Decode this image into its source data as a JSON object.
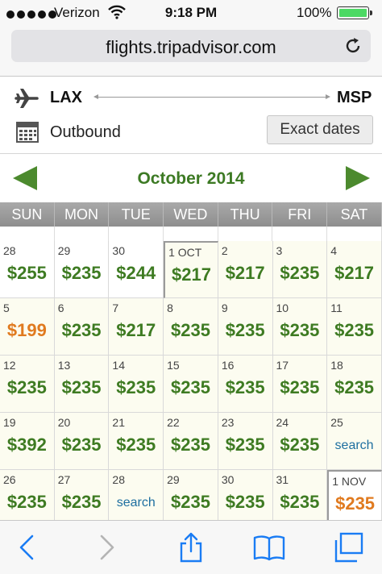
{
  "status": {
    "carrier": "Verizon",
    "time": "9:18 PM",
    "battery": "100%"
  },
  "browser": {
    "url": "flights.tripadvisor.com"
  },
  "route": {
    "origin": "LAX",
    "destination": "MSP",
    "direction": "Outbound",
    "exact_dates_label": "Exact dates"
  },
  "calendar": {
    "month_title": "October 2014",
    "weekdays": [
      "SUN",
      "MON",
      "TUE",
      "WED",
      "THU",
      "FRI",
      "SAT"
    ],
    "weeks": [
      [
        {
          "date": "28",
          "price": "$255"
        },
        {
          "date": "29",
          "price": "$235"
        },
        {
          "date": "30",
          "price": "$244"
        },
        {
          "date": "1 OCT",
          "price": "$217"
        },
        {
          "date": "2",
          "price": "$217"
        },
        {
          "date": "3",
          "price": "$235"
        },
        {
          "date": "4",
          "price": "$217"
        }
      ],
      [
        {
          "date": "5",
          "price": "$199"
        },
        {
          "date": "6",
          "price": "$235"
        },
        {
          "date": "7",
          "price": "$217"
        },
        {
          "date": "8",
          "price": "$235"
        },
        {
          "date": "9",
          "price": "$235"
        },
        {
          "date": "10",
          "price": "$235"
        },
        {
          "date": "11",
          "price": "$235"
        }
      ],
      [
        {
          "date": "12",
          "price": "$235"
        },
        {
          "date": "13",
          "price": "$235"
        },
        {
          "date": "14",
          "price": "$235"
        },
        {
          "date": "15",
          "price": "$235"
        },
        {
          "date": "16",
          "price": "$235"
        },
        {
          "date": "17",
          "price": "$235"
        },
        {
          "date": "18",
          "price": "$235"
        }
      ],
      [
        {
          "date": "19",
          "price": "$392"
        },
        {
          "date": "20",
          "price": "$235"
        },
        {
          "date": "21",
          "price": "$235"
        },
        {
          "date": "22",
          "price": "$235"
        },
        {
          "date": "23",
          "price": "$235"
        },
        {
          "date": "24",
          "price": "$235"
        },
        {
          "date": "25",
          "search": "search"
        }
      ],
      [
        {
          "date": "26",
          "price": "$235"
        },
        {
          "date": "27",
          "price": "$235"
        },
        {
          "date": "28",
          "search": "search"
        },
        {
          "date": "29",
          "price": "$235"
        },
        {
          "date": "30",
          "price": "$235"
        },
        {
          "date": "31",
          "price": "$235"
        },
        {
          "date": "1 NOV",
          "price": "$235"
        }
      ]
    ]
  },
  "colors": {
    "price_green": "#3e7b22",
    "lowest_price_orange": "#e07a1f",
    "nav_arrow_green": "#4c8a2e",
    "link_blue": "#1e6fa0",
    "ios_blue": "#1a7cf4"
  }
}
